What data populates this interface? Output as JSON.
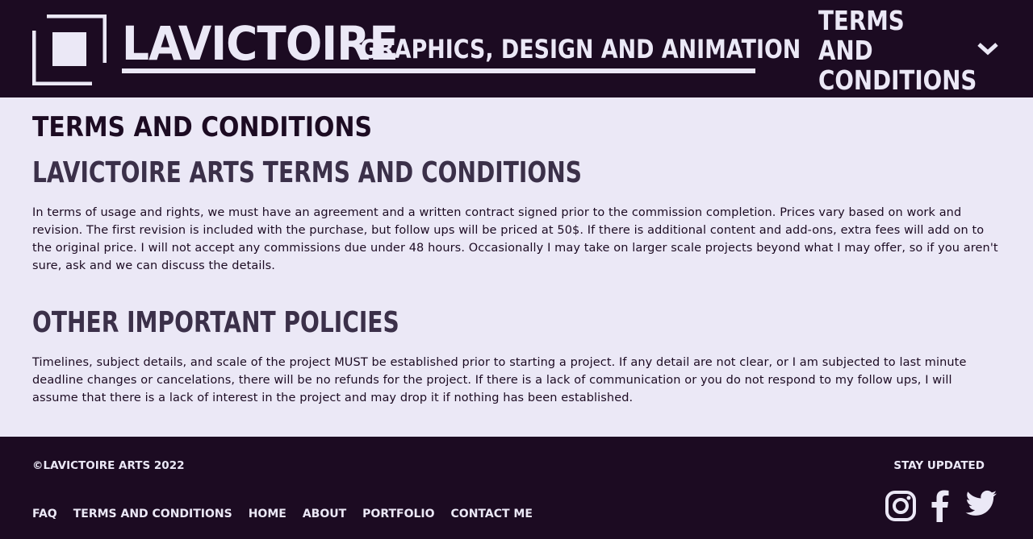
{
  "header": {
    "brand_name": "LAVICTOIRE",
    "tagline": "GRAPHICS, DESIGN AND ANIMATION",
    "nav_current": "TERMS AND CONDITIONS",
    "logo_icon": "logo-square-icon",
    "chevron_icon": "chevron-down-icon"
  },
  "main": {
    "page_title": "TERMS AND CONDITIONS",
    "sections": [
      {
        "heading": "LAVICTOIRE ARTS TERMS AND CONDITIONS",
        "body": "In terms of usage and rights, we must have an agreement and a written contract signed prior to the commission completion. Prices vary based on work and revision. The first revision is included with the purchase, but follow ups will be priced at 50$. If there is additional content and add-ons, extra fees will add on to the original price. I will not accept any commissions due under 48 hours. Occasionally I may take on larger scale projects beyond what I may offer, so if you aren't sure, ask and we can discuss the details."
      },
      {
        "heading": "OTHER IMPORTANT POLICIES",
        "body": "Timelines,  subject details, and scale of the project MUST be established prior to starting a project. If any detail are not clear, or I am subjected to last minute deadline changes or cancelations, there will be no refunds for the project. If there is a lack of communication or you do not respond to my follow ups, I will assume that there is a lack of interest in the project and may drop it if nothing has been established."
      }
    ]
  },
  "footer": {
    "copyright": "©LAVICTOIRE ARTS 2022",
    "stay_updated": "STAY UPDATED",
    "links": [
      "FAQ",
      "TERMS AND CONDITIONS",
      "HOME",
      "ABOUT",
      "PORTFOLIO",
      "CONTACT ME"
    ],
    "socials": [
      "instagram-icon",
      "facebook-icon",
      "twitter-icon"
    ]
  },
  "colors": {
    "dark": "#1c0b22",
    "light": "#ebe8f6",
    "heading_muted": "#3b3049"
  }
}
